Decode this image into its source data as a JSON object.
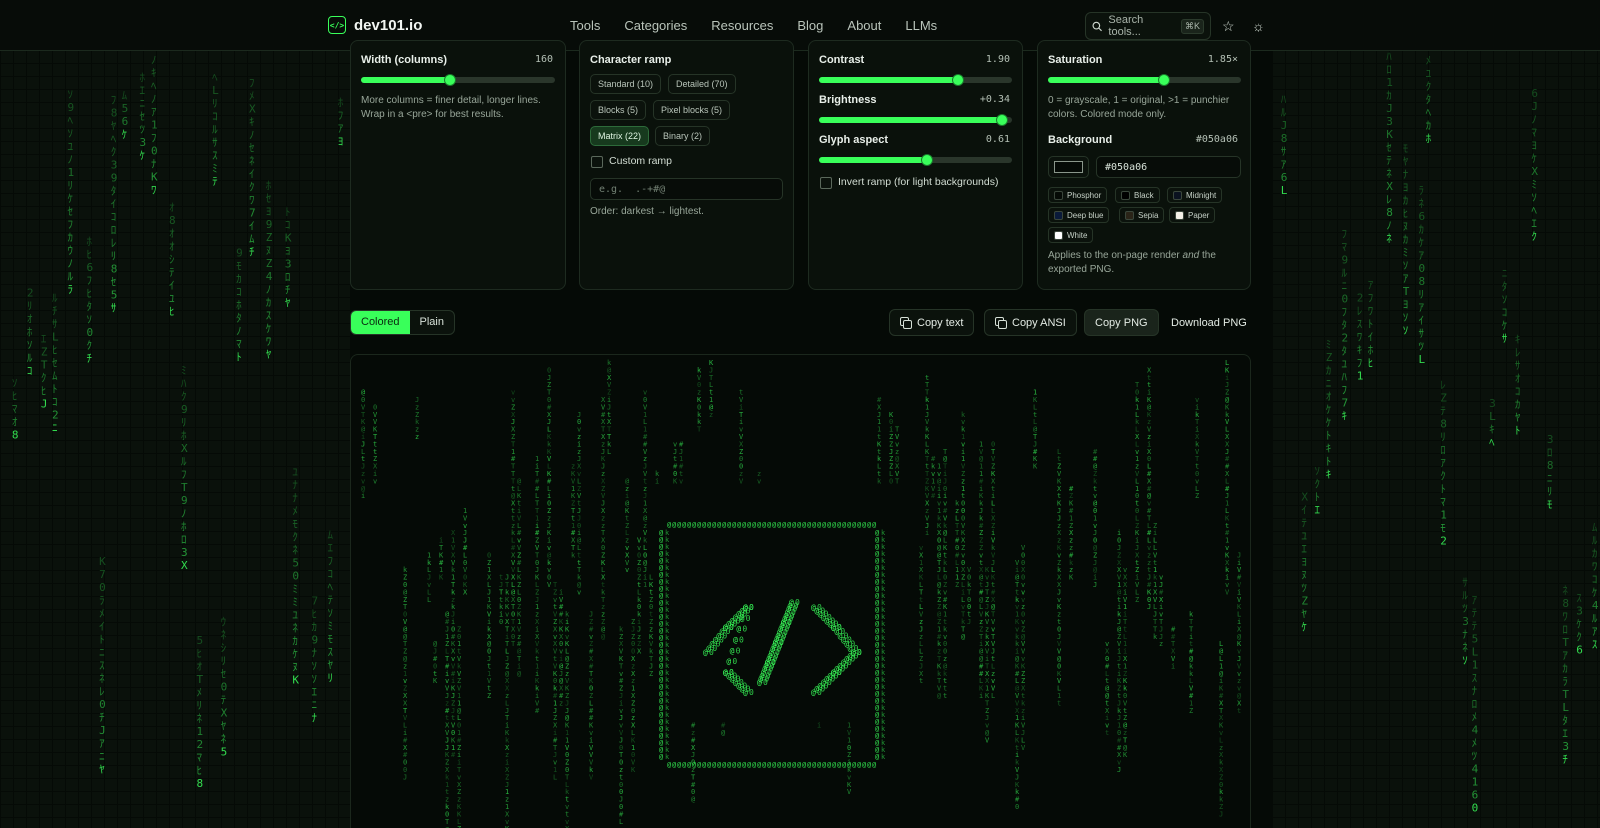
{
  "header": {
    "logo_icon": "code-brackets-icon",
    "logo_glyph": "</>",
    "brand": "dev101.io",
    "nav": [
      "Tools",
      "Categories",
      "Resources",
      "Blog",
      "About",
      "LLMs"
    ],
    "search_placeholder": "Search tools...",
    "search_shortcut": "⌘K",
    "star_icon": "star-icon",
    "theme_icon": "sun-icon"
  },
  "width_panel": {
    "label": "Width (columns)",
    "value": "160",
    "slider_fraction": 0.46,
    "help": "More columns = finer detail, longer lines. Wrap in a <pre> for best results."
  },
  "ramp_panel": {
    "label": "Character ramp",
    "options": [
      "Standard (10)",
      "Detailed (70)",
      "Blocks (5)",
      "Pixel blocks (5)",
      "Matrix (22)",
      "Binary (2)"
    ],
    "selected": "Matrix (22)",
    "custom_label": "Custom ramp",
    "custom_placeholder": "e.g.  .-+#@",
    "order_note": "Order: darkest → lightest."
  },
  "tone_panel": {
    "contrast_label": "Contrast",
    "contrast_value": "1.90",
    "contrast_fraction": 0.72,
    "brightness_label": "Brightness",
    "brightness_value": "+0.34",
    "brightness_fraction": 0.95,
    "glyph_label": "Glyph aspect",
    "glyph_value": "0.61",
    "glyph_fraction": 0.56,
    "invert_label": "Invert ramp (for light backgrounds)"
  },
  "color_panel": {
    "saturation_label": "Saturation",
    "saturation_value": "1.85×",
    "saturation_fraction": 0.6,
    "saturation_help": "0 = grayscale, 1 = original, >1 = punchier colors. Colored mode only.",
    "background_label": "Background",
    "background_value": "#050a06",
    "background_input": "#050a06",
    "swatches": [
      {
        "name": "Phosphor",
        "color": "#050a06"
      },
      {
        "name": "Black",
        "color": "#000000"
      },
      {
        "name": "Midnight",
        "color": "#0b1220"
      },
      {
        "name": "Deep blue",
        "color": "#0a1a3a"
      },
      {
        "name": "Sepia",
        "color": "#2a2418"
      },
      {
        "name": "Paper",
        "color": "#f4f1e8"
      },
      {
        "name": "White",
        "color": "#ffffff"
      }
    ],
    "applies_prefix": "Applies to the on-page render ",
    "applies_em": "and",
    "applies_suffix": " the exported PNG."
  },
  "toolbar": {
    "mode_colored": "Colored",
    "mode_plain": "Plain",
    "copy_text": "Copy text",
    "copy_ansi": "Copy ANSI",
    "copy_png": "Copy PNG",
    "download_png": "Download PNG"
  },
  "colors": {
    "accent": "#39ff5a",
    "page_bg": "#050a06"
  }
}
